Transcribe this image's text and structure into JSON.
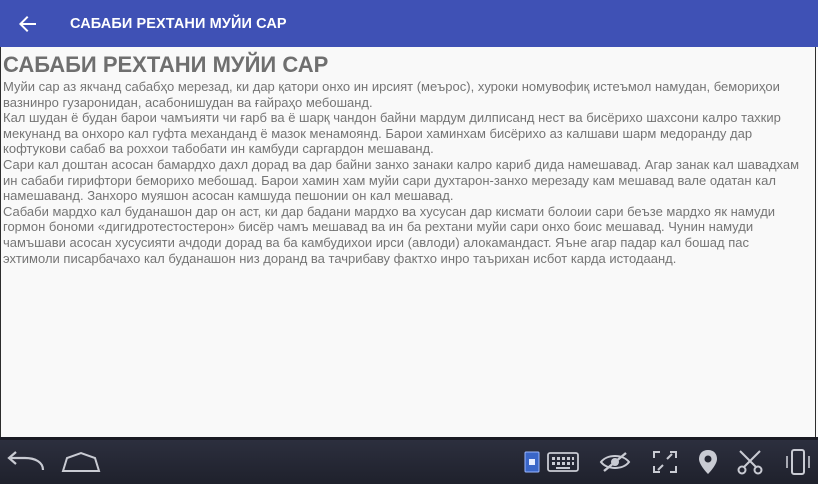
{
  "app_bar": {
    "title": "САБАБИ РЕХТАНИ МУЙИ САР",
    "back_icon": "arrow-back-icon"
  },
  "article": {
    "heading": "САБАБИ РЕХТАНИ МУЙИ САР",
    "paragraphs": [
      "Муйи сар аз якчанд сабабҳо мерезад, ки дар қатори онхо ин ирсият (меърос), хуроки номувофиқ истеъмол намудан,  бемориҳои вазнинро гузаронидан, асабонишудан ва ғайраҳо мебошанд.",
      "Кал шудан ё будан барои чамъияти чи ғарб ва ё шарқ чандон байни мардум дилписанд нест ва бисёрихо шахсони калро тахкир мекунанд ва онхоро кал гуфта механданд ё мазок менамоянд. Барои хаминхам бисёрихо аз калшави шарм медоранду дар кофтукови сабаб ва роххои табобати ин камбуди саргардон мешаванд.",
      "Сари кал доштан асосан бамардхо дахл дорад ва дар байни занхо занаки калро кариб дида намешавад. Агар занак кал шавадхам ин сабаби гирифтори беморихо мебошад. Барои хамин хам муйи сари духтарон-занхо мерезаду кам мешавад вале одатан кал намешаванд. Занхоро муяшон асосан камшуда пешонии он кал мешавад.",
      "Сабаби мардхо кал буданашон дар он аст, ки дар бадани мардхо ва хусусан дар кисмати болоии сари беъзе мардхо як намуди гормон бономи «дигидротестостерон» бисёр чамъ мешавад ва ин ба рехтани муйи сари онхо боис мешавад. Чунин намуди чамъшави асосан хусусияти ачдоди дорад ва ба камбудихои ирси (авлоди) алокамандаст.  Яъне агар падар кал бошад пас эхтимоли писарбачахо кал буданашон низ доранд ва тачрибаву фактхо инро таърихан исбот карда истодаанд."
    ]
  },
  "nav_bar": {
    "icons": [
      "back-nav-icon",
      "home-icon",
      "screen-icon",
      "keyboard-icon",
      "visibility-off-icon",
      "fullscreen-icon",
      "location-icon",
      "cut-icon",
      "rotate-device-icon"
    ]
  },
  "colors": {
    "app_bar": "#3f51b5",
    "nav_bar": "#262834",
    "text": "#757575"
  }
}
